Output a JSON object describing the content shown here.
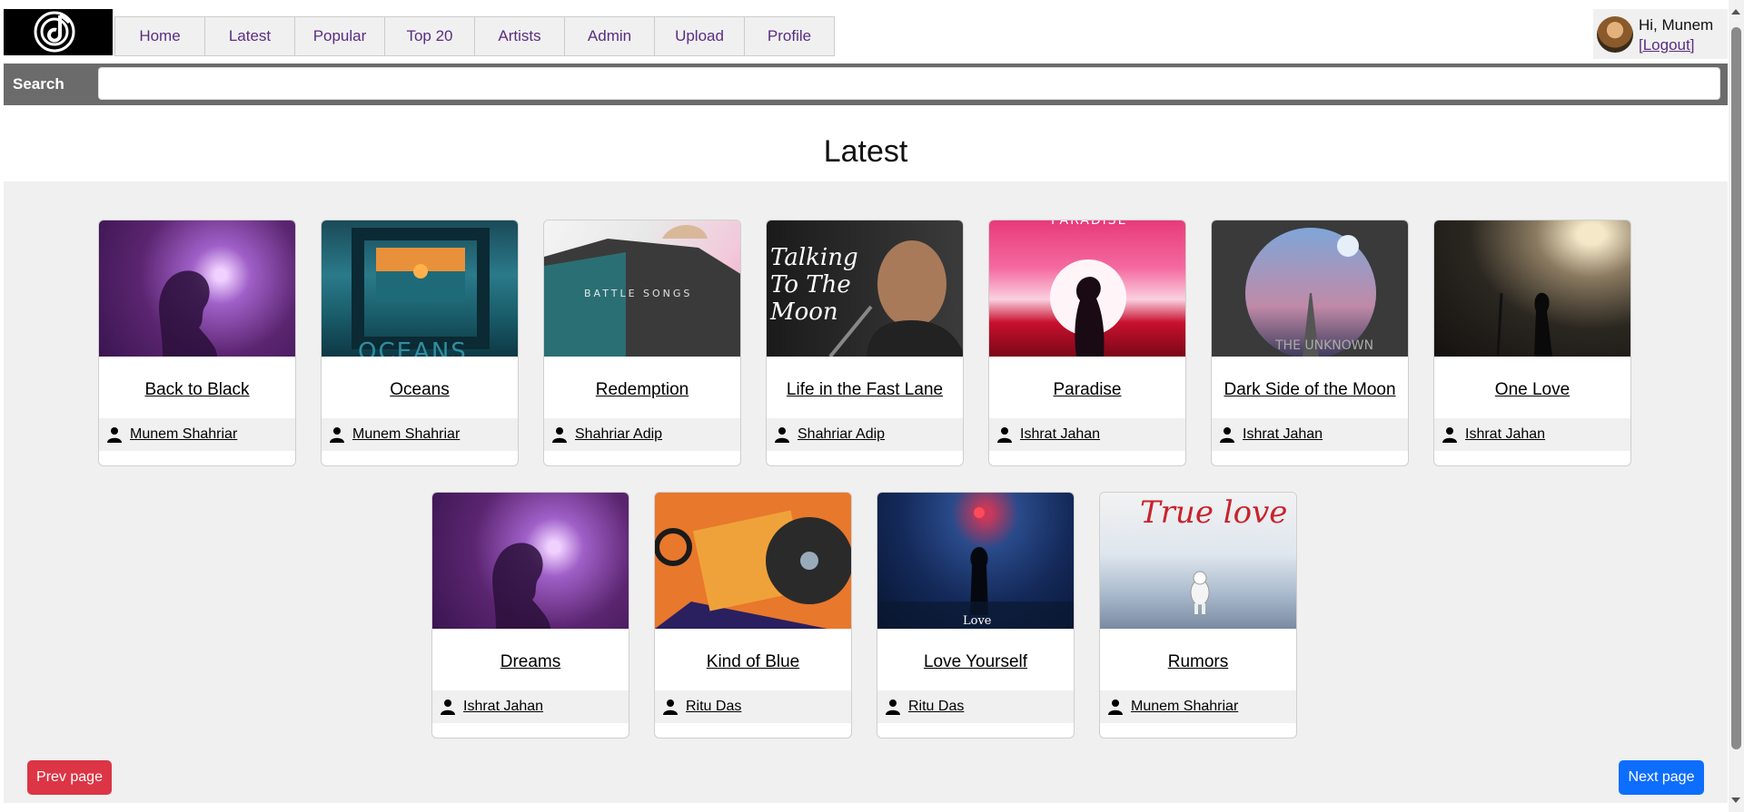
{
  "nav": {
    "items": [
      "Home",
      "Latest",
      "Popular",
      "Top 20",
      "Artists",
      "Admin",
      "Upload",
      "Profile"
    ]
  },
  "user": {
    "greeting": "Hi, Munem",
    "logout": "[Logout]"
  },
  "search": {
    "label": "Search",
    "value": "",
    "placeholder": ""
  },
  "page": {
    "title": "Latest"
  },
  "songs": [
    {
      "title": "Back to Black",
      "artist": "Munem Shahriar",
      "cover_text": ""
    },
    {
      "title": "Oceans",
      "artist": "Munem Shahriar",
      "cover_text": "OCEANS"
    },
    {
      "title": "Redemption",
      "artist": "Shahriar Adip",
      "cover_text": "BATTLE SONGS"
    },
    {
      "title": "Life in the Fast Lane",
      "artist": "Shahriar Adip",
      "cover_text": "Talking To The Moon"
    },
    {
      "title": "Paradise",
      "artist": "Ishrat Jahan",
      "cover_text": "PARADISE"
    },
    {
      "title": "Dark Side of the Moon",
      "artist": "Ishrat Jahan",
      "cover_text": "THE UNKNOWN"
    },
    {
      "title": "One Love",
      "artist": "Ishrat Jahan",
      "cover_text": ""
    },
    {
      "title": "Dreams",
      "artist": "Ishrat Jahan",
      "cover_text": ""
    },
    {
      "title": "Kind of Blue",
      "artist": "Ritu Das",
      "cover_text": ""
    },
    {
      "title": "Love Yourself",
      "artist": "Ritu Das",
      "cover_text": "Love"
    },
    {
      "title": "Rumors",
      "artist": "Munem Shahriar",
      "cover_text": "True love"
    }
  ],
  "pagination": {
    "prev": "Prev page",
    "next": "Next page"
  },
  "colors": {
    "nav_link": "#5a2d82",
    "prev_button": "#dc3545",
    "next_button": "#0d6efd",
    "search_bar": "#6b6b6b",
    "content_bg": "#f0f0f0"
  }
}
